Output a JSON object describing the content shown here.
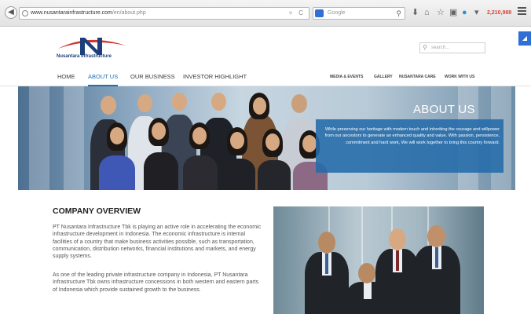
{
  "browser": {
    "url_host": "www.nusantarainfrastructure.com",
    "url_path": "/en/about.php",
    "search_placeholder": "Google",
    "counter": "2,210,988"
  },
  "header": {
    "logo_text": "Nusantara Infrastructure",
    "search_placeholder": "search..."
  },
  "nav": {
    "main": [
      "HOME",
      "ABOUT US",
      "OUR BUSINESS",
      "INVESTOR HIGHLIGHT"
    ],
    "active_index": 1,
    "secondary": [
      "MEDIA & EVENTS",
      "GALLERY",
      "NUSANTARA CARE",
      "WORK WITH US"
    ]
  },
  "hero": {
    "title": "ABOUT US",
    "text": "While preserving our heritage with modern touch and inheriting the courage and willpower from our ancestors to generate an enhanced quality and value. With passion, persistence, commitment and hard work, We will work together to bring this country forward."
  },
  "overview": {
    "title": "COMPANY OVERVIEW",
    "paragraphs": [
      "PT Nusantara Infrastructure Tbk is playing an active role in accelerating the economic infrastructure development in Indonesia. The economic infrastructure is internal facilities of a country that make business activities possible, such as transportation, communication, distribution networks, financial institutions and markets, and energy supply systems.",
      "As one of the leading private infrastructure company in Indonesia, PT Nusantara Infrastructure Tbk owns infrastructure concessions in both western and eastern parts of Indonesia which provide sustained growth to the business."
    ]
  },
  "colors": {
    "brand_blue": "#1f6fb5",
    "logo_red": "#d0342c",
    "logo_navy": "#1c3e7a",
    "hero_box": "#246baa"
  }
}
